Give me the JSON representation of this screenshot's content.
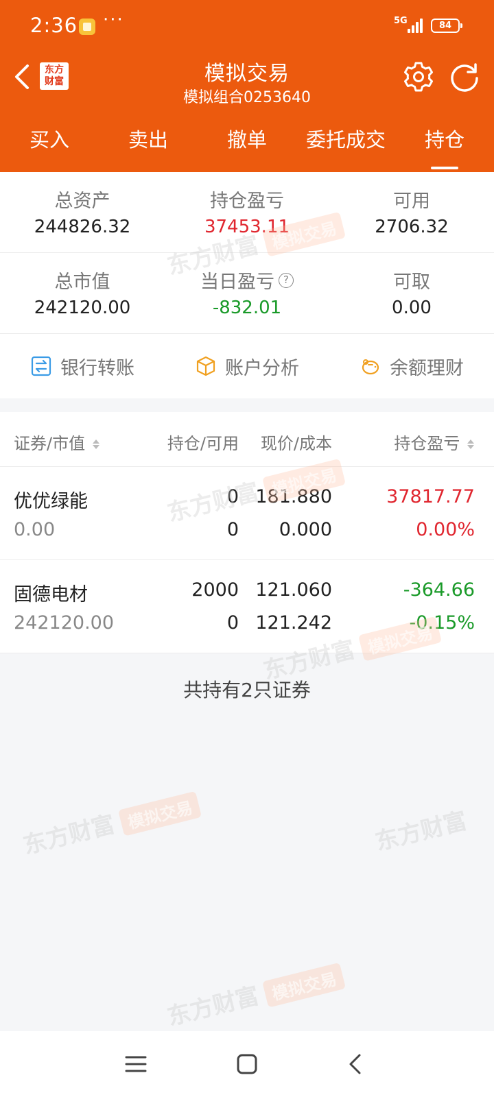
{
  "status": {
    "time": "2:36",
    "dots": "···",
    "network": "5G",
    "battery": "84"
  },
  "header": {
    "logo_top": "东方",
    "logo_bottom": "财富",
    "title": "模拟交易",
    "subtitle": "模拟组合0253640",
    "tabs": [
      {
        "label": "买入"
      },
      {
        "label": "卖出"
      },
      {
        "label": "撤单"
      },
      {
        "label": "委托成交"
      },
      {
        "label": "持仓"
      }
    ],
    "active_tab": "持仓"
  },
  "summary": {
    "total_assets": {
      "label": "总资产",
      "value": "244826.32"
    },
    "position_pnl": {
      "label": "持仓盈亏",
      "value": "37453.11"
    },
    "available": {
      "label": "可用",
      "value": "2706.32"
    },
    "market_value": {
      "label": "总市值",
      "value": "242120.00"
    },
    "daily_pnl": {
      "label": "当日盈亏",
      "value": "-832.01"
    },
    "withdrawable": {
      "label": "可取",
      "value": "0.00"
    }
  },
  "actions": {
    "bank_transfer": "银行转账",
    "account_analysis": "账户分析",
    "balance_finance": "余额理财"
  },
  "table": {
    "headers": {
      "security": "证券/市值",
      "position": "持仓/可用",
      "price": "现价/成本",
      "pnl": "持仓盈亏"
    },
    "rows": [
      {
        "name": "优优绿能",
        "market_value": "0.00",
        "position": "0",
        "available": "0",
        "price": "181.880",
        "cost": "0.000",
        "pnl": "37817.77",
        "pnl_pct": "0.00%",
        "color": "#e0262f"
      },
      {
        "name": "固德电材",
        "market_value": "242120.00",
        "position": "2000",
        "available": "0",
        "price": "121.060",
        "cost": "121.242",
        "pnl": "-364.66",
        "pnl_pct": "-0.15%",
        "color": "#1a9a29"
      }
    ],
    "footer": "共持有2只证券"
  },
  "watermark": {
    "brand": "东方财富",
    "tag": "模拟交易"
  },
  "colors": {
    "brand": "#ec5a0e",
    "up": "#e0262f",
    "down": "#1a9a29"
  }
}
